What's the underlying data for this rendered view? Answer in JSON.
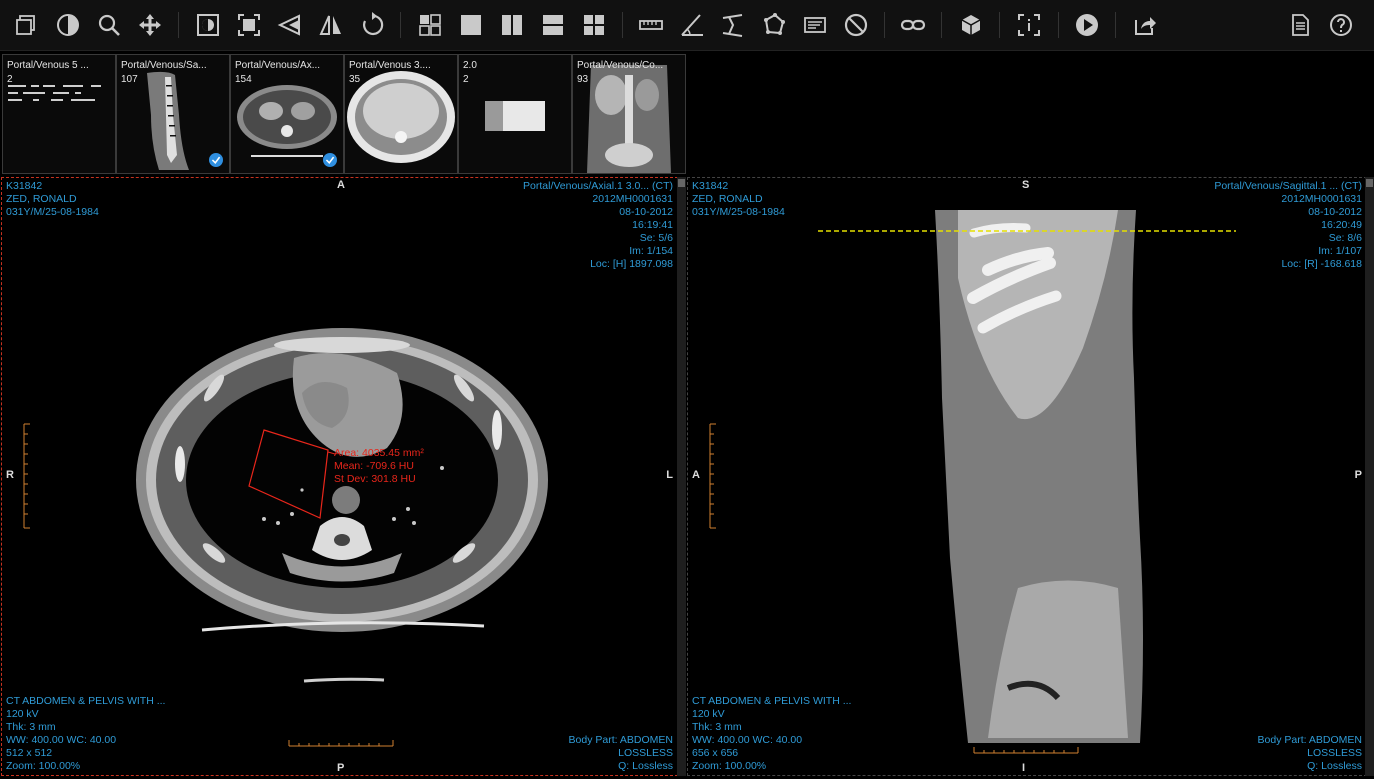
{
  "toolbar": {
    "tools": [
      {
        "name": "series-layout-icon",
        "label": "Series"
      },
      {
        "name": "window-level-icon",
        "label": "Window/Level"
      },
      {
        "name": "zoom-icon",
        "label": "Zoom"
      },
      {
        "name": "pan-icon",
        "label": "Pan"
      },
      {
        "name": "invert-icon",
        "label": "Invert"
      },
      {
        "name": "fit-icon",
        "label": "Fit"
      },
      {
        "name": "flip-vertical-icon",
        "label": "Flip Vertical"
      },
      {
        "name": "flip-horizontal-icon",
        "label": "Flip Horizontal"
      },
      {
        "name": "reset-icon",
        "label": "Reset"
      },
      {
        "name": "layout-1x1-quad-icon",
        "label": "Layout"
      },
      {
        "name": "layout-1x1-icon",
        "label": "1x1"
      },
      {
        "name": "layout-1x2-icon",
        "label": "1x2"
      },
      {
        "name": "layout-2x1-icon",
        "label": "2x1"
      },
      {
        "name": "layout-2x2-icon",
        "label": "2x2"
      },
      {
        "name": "ruler-icon",
        "label": "Length"
      },
      {
        "name": "angle-icon",
        "label": "Angle"
      },
      {
        "name": "cobb-angle-icon",
        "label": "Cobb Angle"
      },
      {
        "name": "roi-icon",
        "label": "ROI"
      },
      {
        "name": "annotation-icon",
        "label": "Annotate"
      },
      {
        "name": "clear-icon",
        "label": "Clear"
      },
      {
        "name": "link-icon",
        "label": "Link"
      },
      {
        "name": "3d-cube-icon",
        "label": "3D"
      },
      {
        "name": "info-icon",
        "label": "Info"
      },
      {
        "name": "play-icon",
        "label": "Cine"
      },
      {
        "name": "share-icon",
        "label": "Share"
      },
      {
        "name": "report-icon",
        "label": "Report"
      },
      {
        "name": "help-icon",
        "label": "Help"
      }
    ]
  },
  "thumbnails": [
    {
      "title": "Portal/Venous 5 ...",
      "count": "2",
      "checked": false
    },
    {
      "title": "Portal/Venous/Sa...",
      "count": "107",
      "checked": true
    },
    {
      "title": "Portal/Venous/Ax...",
      "count": "154",
      "checked": true
    },
    {
      "title": "Portal/Venous 3....",
      "count": "35",
      "checked": false
    },
    {
      "title": "2.0",
      "count": "2",
      "checked": false
    },
    {
      "title": "Portal/Venous/Co...",
      "count": "93",
      "checked": false
    }
  ],
  "left_viewport": {
    "top_left": [
      "K31842",
      "ZED, RONALD",
      "031Y/M/25-08-1984"
    ],
    "top_right": [
      "Portal/Venous/Axial.1 3.0... (CT)",
      "2012MH0001631",
      "08-10-2012",
      "16:19:41",
      "Se: 5/6",
      "Im: 1/154",
      "Loc: [H] 1897.098"
    ],
    "bottom_left": [
      "CT ABDOMEN & PELVIS WITH ...",
      "120 kV",
      "Thk: 3 mm",
      "WW: 400.00 WC: 40.00",
      "512 x 512",
      "Zoom: 100.00%"
    ],
    "bottom_right": [
      "Body Part: ABDOMEN",
      "LOSSLESS",
      "Q: Lossless"
    ],
    "orient": {
      "top": "A",
      "bottom": "P",
      "left": "R",
      "right": "L"
    },
    "measurement": [
      "Area: 4035.45 mm²",
      "Mean: -709.6 HU",
      "St Dev: 301.8 HU"
    ]
  },
  "right_viewport": {
    "top_left": [
      "K31842",
      "ZED, RONALD",
      "031Y/M/25-08-1984"
    ],
    "top_right": [
      "Portal/Venous/Sagittal.1 ... (CT)",
      "2012MH0001631",
      "08-10-2012",
      "16:20:49",
      "Se: 8/6",
      "Im: 1/107",
      "Loc: [R] -168.618"
    ],
    "bottom_left": [
      "CT ABDOMEN & PELVIS WITH ...",
      "120 kV",
      "Thk: 3 mm",
      "WW: 400.00 WC: 40.00",
      "656 x 656",
      "Zoom: 100.00%"
    ],
    "bottom_right": [
      "Body Part: ABDOMEN",
      "LOSSLESS",
      "Q: Lossless"
    ],
    "orient": {
      "top": "S",
      "bottom": "I",
      "left": "A",
      "right": "P"
    }
  },
  "colors": {
    "overlay": "#2f9bd6",
    "measurement": "#e8261b",
    "reference_line": "#e5e000",
    "active_border": "#c8321f"
  }
}
